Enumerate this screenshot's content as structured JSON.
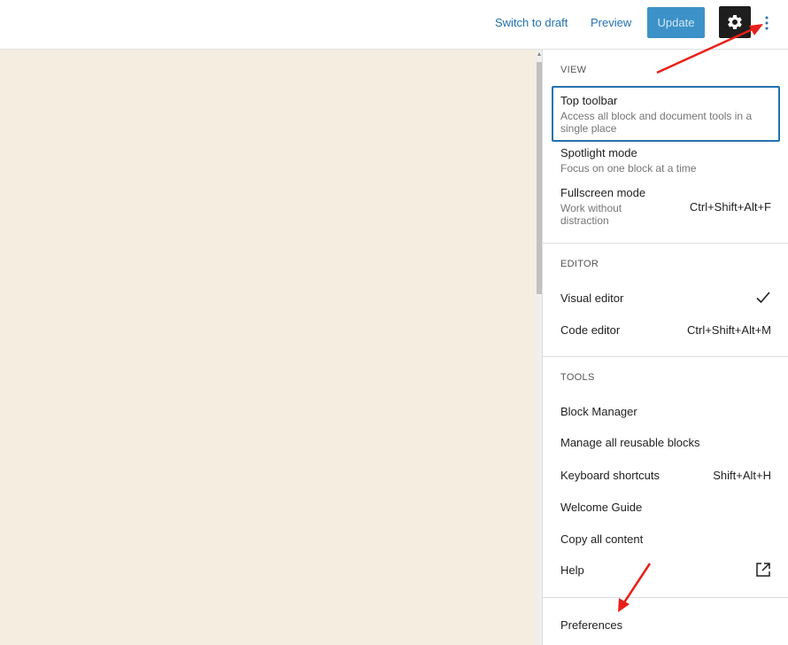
{
  "header": {
    "switch_to_draft": "Switch to draft",
    "preview": "Preview",
    "update": "Update",
    "settings_icon": "gear-icon",
    "more_icon": "more-vertical-icon"
  },
  "menu": {
    "view": {
      "label": "VIEW",
      "items": [
        {
          "title": "Top toolbar",
          "desc": "Access all block and document tools in a single place",
          "shortcut": ""
        },
        {
          "title": "Spotlight mode",
          "desc": "Focus on one block at a time",
          "shortcut": ""
        },
        {
          "title": "Fullscreen mode",
          "desc": "Work without distraction",
          "shortcut": "Ctrl+Shift+Alt+F"
        }
      ]
    },
    "editor": {
      "label": "EDITOR",
      "items": [
        {
          "title": "Visual editor",
          "shortcut": "",
          "checked": true
        },
        {
          "title": "Code editor",
          "shortcut": "Ctrl+Shift+Alt+M"
        }
      ]
    },
    "tools": {
      "label": "TOOLS",
      "items": [
        {
          "title": "Block Manager",
          "shortcut": ""
        },
        {
          "title": "Manage all reusable blocks",
          "shortcut": ""
        },
        {
          "title": "Keyboard shortcuts",
          "shortcut": "Shift+Alt+H"
        },
        {
          "title": "Welcome Guide",
          "shortcut": ""
        },
        {
          "title": "Copy all content",
          "shortcut": ""
        },
        {
          "title": "Help",
          "shortcut": "",
          "icon": "external-link-icon"
        }
      ]
    },
    "preferences": {
      "title": "Preferences"
    }
  },
  "colors": {
    "accent": "#2271b1",
    "canvas": "#f4ede0",
    "annotation_arrow": "#e8201a"
  }
}
